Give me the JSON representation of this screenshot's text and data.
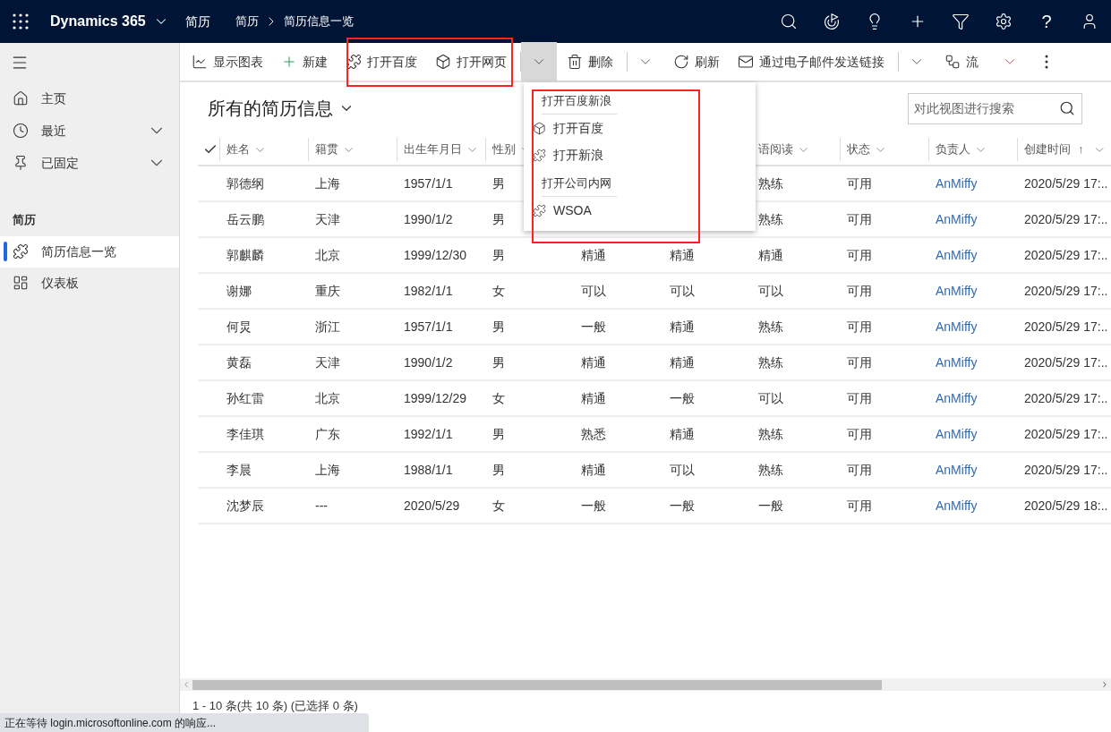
{
  "top_bar": {
    "app_name": "Dynamics 365",
    "area": "简历",
    "breadcrumb": [
      "简历",
      "简历信息一览"
    ],
    "help": "?"
  },
  "sidebar": {
    "items": [
      {
        "label": "主页",
        "expandable": false
      },
      {
        "label": "最近",
        "expandable": true
      },
      {
        "label": "已固定",
        "expandable": true
      }
    ],
    "group": "简历",
    "group_items": [
      {
        "label": "简历信息一览",
        "selected": true
      },
      {
        "label": "仪表板",
        "selected": false
      }
    ]
  },
  "toolbar": [
    {
      "kind": "button",
      "label": "显示图表"
    },
    {
      "kind": "button",
      "label": "新建"
    },
    {
      "kind": "button",
      "label": "打开百度"
    },
    {
      "kind": "button",
      "label": "打开网页"
    },
    {
      "kind": "menu",
      "split": true,
      "expanded": true
    },
    {
      "kind": "button",
      "label": "删除"
    },
    {
      "kind": "menu",
      "split": true,
      "expanded": false
    },
    {
      "kind": "button",
      "label": "刷新"
    },
    {
      "kind": "button",
      "label": "通过电子邮件发送链接"
    },
    {
      "kind": "menu",
      "split": true,
      "expanded": false
    },
    {
      "kind": "button",
      "label": "流"
    },
    {
      "kind": "menu",
      "split": false,
      "expanded": false
    },
    {
      "kind": "more"
    }
  ],
  "dropdown_menu": [
    {
      "kind": "heading",
      "label": "打开百度新浪"
    },
    {
      "kind": "item",
      "label": "打开百度"
    },
    {
      "kind": "item",
      "label": "打开新浪"
    },
    {
      "kind": "heading",
      "label": "打开公司内网"
    },
    {
      "kind": "item",
      "label": "WSOA"
    }
  ],
  "view": {
    "title": "所有的简历信息",
    "search": {
      "placeholder": "对此视图进行搜索"
    }
  },
  "table": {
    "header": {
      "name": "姓名",
      "native_place": "籍贯",
      "birth": "出生年月日",
      "gender": "性别",
      "column_7": "语阅读",
      "status": "状态",
      "owner": "负责人",
      "created": "创建时间"
    },
    "sort_mark": "↑",
    "rows": [
      {
        "name": "郭德纲",
        "native_place": "上海",
        "birth": "1957/1/1",
        "gender": "男",
        "column_7": "熟练",
        "status": "可用",
        "owner": "AnMiffy",
        "created": "2020/5/29 17:.."
      },
      {
        "name": "岳云鹏",
        "native_place": "天津",
        "birth": "1990/1/2",
        "gender": "男",
        "column_7": "熟练",
        "status": "可用",
        "owner": "AnMiffy",
        "created": "2020/5/29 17:.."
      },
      {
        "name": "郭麒麟",
        "native_place": "北京",
        "birth": "1999/12/30",
        "gender": "男",
        "column_5": "精通",
        "column_6": "精通",
        "column_7": "精通",
        "status": "可用",
        "owner": "AnMiffy",
        "created": "2020/5/29 17:.."
      },
      {
        "name": "谢娜",
        "native_place": "重庆",
        "birth": "1982/1/1",
        "gender": "女",
        "column_5": "可以",
        "column_6": "可以",
        "column_7": "可以",
        "status": "可用",
        "owner": "AnMiffy",
        "created": "2020/5/29 17:.."
      },
      {
        "name": "何炅",
        "native_place": "浙江",
        "birth": "1957/1/1",
        "gender": "男",
        "column_5": "一般",
        "column_6": "精通",
        "column_7": "熟练",
        "status": "可用",
        "owner": "AnMiffy",
        "created": "2020/5/29 17:.."
      },
      {
        "name": "黄磊",
        "native_place": "天津",
        "birth": "1990/1/2",
        "gender": "男",
        "column_5": "精通",
        "column_6": "精通",
        "column_7": "熟练",
        "status": "可用",
        "owner": "AnMiffy",
        "created": "2020/5/29 17:.."
      },
      {
        "name": "孙红雷",
        "native_place": "北京",
        "birth": "1999/12/29",
        "gender": "女",
        "column_5": "精通",
        "column_6": "一般",
        "column_7": "可以",
        "status": "可用",
        "owner": "AnMiffy",
        "created": "2020/5/29 17:.."
      },
      {
        "name": "李佳琪",
        "native_place": "广东",
        "birth": "1992/1/1",
        "gender": "男",
        "column_5": "熟悉",
        "column_6": "精通",
        "column_7": "熟练",
        "status": "可用",
        "owner": "AnMiffy",
        "created": "2020/5/29 17:.."
      },
      {
        "name": "李晨",
        "native_place": "上海",
        "birth": "1988/1/1",
        "gender": "男",
        "column_5": "精通",
        "column_6": "可以",
        "column_7": "熟练",
        "status": "可用",
        "owner": "AnMiffy",
        "created": "2020/5/29 17:.."
      },
      {
        "name": "沈梦辰",
        "native_place": "---",
        "birth": "2020/5/29",
        "gender": "女",
        "column_5": "一般",
        "column_6": "一般",
        "column_7": "一般",
        "status": "可用",
        "owner": "AnMiffy",
        "created": "2020/5/29 18:.."
      }
    ],
    "footer": "1 - 10 条(共 10 条) (已选择 0 条)"
  },
  "status_bubble": "正在等待 login.microsoftonline.com 的响应..."
}
